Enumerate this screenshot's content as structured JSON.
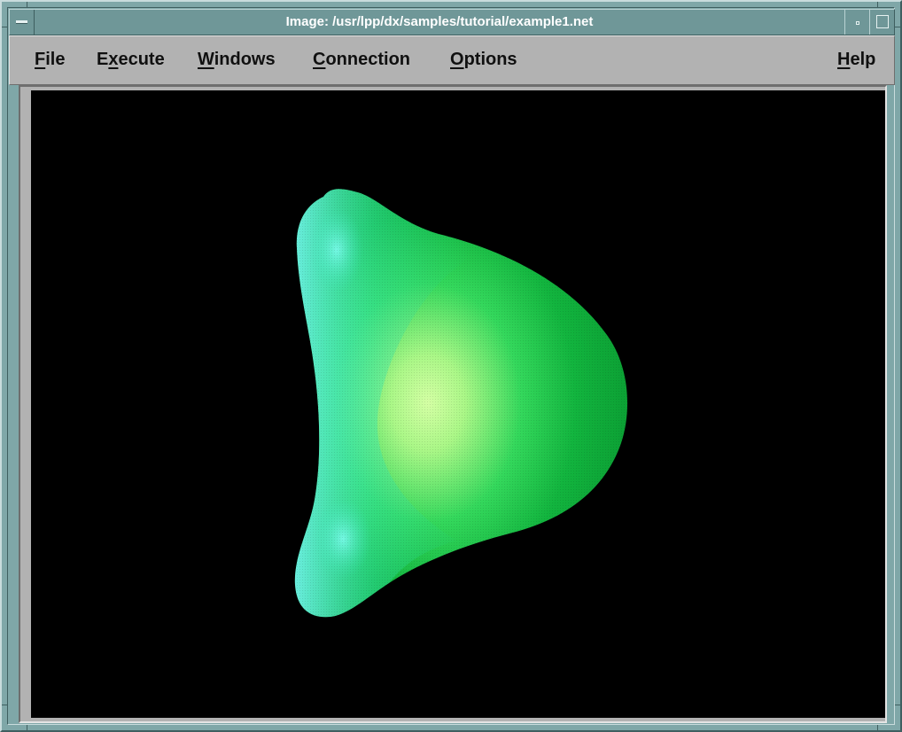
{
  "window": {
    "title": "Image: /usr/lpp/dx/samples/tutorial/example1.net"
  },
  "menubar": {
    "items": [
      {
        "mnemonic": "F",
        "rest": "ile"
      },
      {
        "mnemonic": "",
        "rest": "E",
        "mnemonic2": "x",
        "rest2": "ecute"
      },
      {
        "mnemonic": "W",
        "rest": "indows"
      },
      {
        "mnemonic": "C",
        "rest": "onnection"
      },
      {
        "mnemonic": "O",
        "rest": "ptions"
      },
      {
        "mnemonic": "H",
        "rest": "elp"
      }
    ]
  },
  "icons": {
    "system_menu": "window-menu-icon",
    "minimize": "minimize-icon",
    "maximize": "maximize-icon"
  },
  "colors": {
    "frame": "#7fa7a8",
    "menubar": "#b2b2b2",
    "canvas_background": "#000000",
    "surface_highlight": "#c9ff9a",
    "surface_mid": "#19d64a",
    "surface_edge": "#6ff0e6"
  }
}
